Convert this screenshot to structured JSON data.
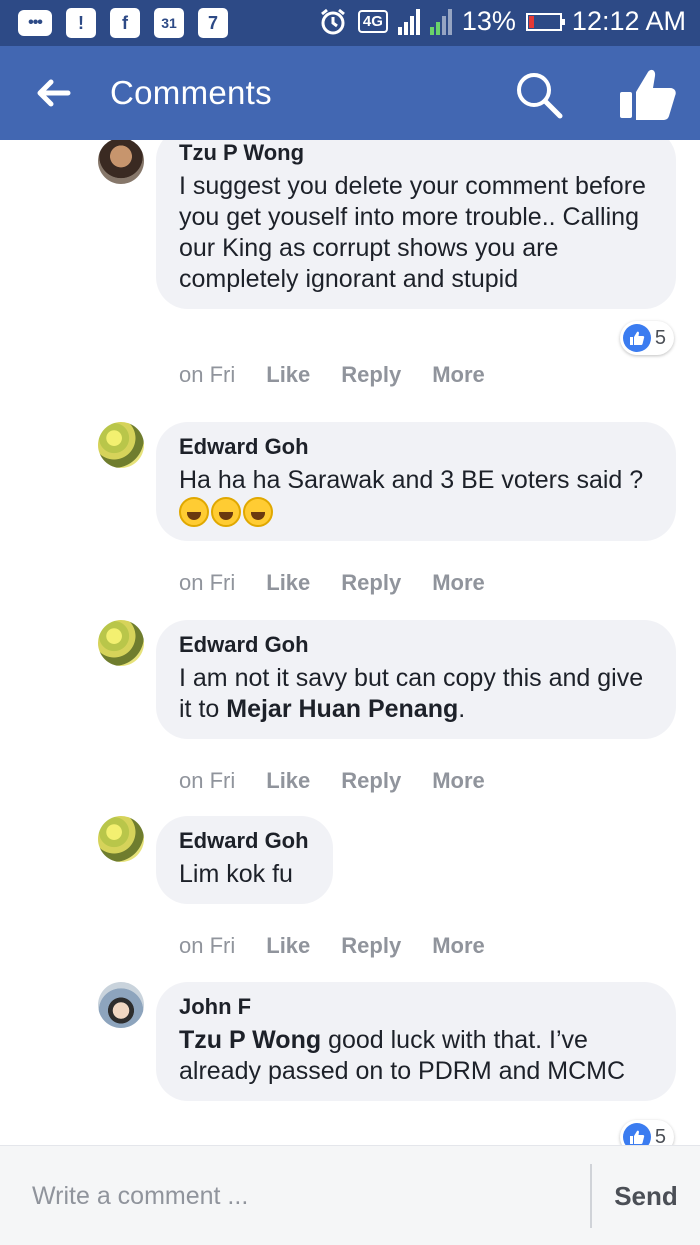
{
  "status_bar": {
    "left_icons": [
      "chat-bubble-icon",
      "alert-icon",
      "facebook-icon",
      "calendar-icon",
      "weather-icon"
    ],
    "calendar_day": "31",
    "network": "4G",
    "sim1": "1",
    "sim2": "2",
    "battery": "13%",
    "time": "12:12 AM",
    "alarm_icon": "alarm-icon"
  },
  "app_bar": {
    "title": "Comments",
    "back_icon": "back-arrow-icon",
    "search_icon": "search-icon",
    "like_icon": "thumbs-up-icon",
    "color": "#4267b2"
  },
  "comments": [
    {
      "author": "Tzu P Wong",
      "text": "I suggest you delete your comment before you get youself into more trouble.. Calling our King as corrupt shows you are completely ignorant and stupid",
      "time": "on Fri",
      "like": "Like",
      "reply": "Reply",
      "more": "More",
      "reactions": "5"
    },
    {
      "author": "Edward Goh",
      "text": "Ha ha ha Sarawak and 3 BE voters said ?",
      "emojis": [
        "grinning-sweat-icon",
        "tears-of-joy-icon",
        "grinning-icon"
      ],
      "time": "on Fri",
      "like": "Like",
      "reply": "Reply",
      "more": "More"
    },
    {
      "author": "Edward Goh",
      "text_before": "I am not it savy but can copy this and give it to ",
      "mention": "Mejar Huan Penang",
      "text_after": ".",
      "time": "on Fri",
      "like": "Like",
      "reply": "Reply",
      "more": "More"
    },
    {
      "author": "Edward Goh",
      "text": "Lim kok fu",
      "time": "on Fri",
      "like": "Like",
      "reply": "Reply",
      "more": "More"
    },
    {
      "author": "John F",
      "mention": "Tzu P Wong",
      "text_after": " good luck with that. I’ve already passed on to PDRM and MCMC",
      "reactions": "5"
    }
  ],
  "footer": {
    "placeholder": "Write a comment ...",
    "send_label": "Send"
  }
}
